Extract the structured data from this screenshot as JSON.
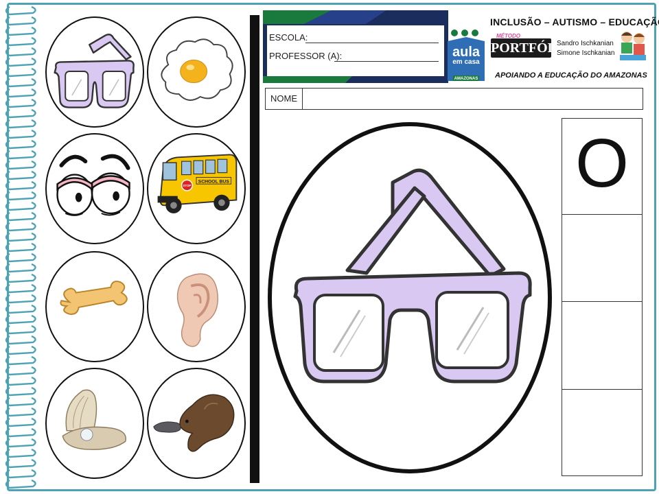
{
  "pictures": [
    {
      "name": "oculos"
    },
    {
      "name": "ovo"
    },
    {
      "name": "olhos"
    },
    {
      "name": "onibus",
      "bus_sign": "SCHOOL BUS",
      "stop_sign": "STOP"
    },
    {
      "name": "osso"
    },
    {
      "name": "orelha"
    },
    {
      "name": "ostra"
    },
    {
      "name": "ornitorrinco"
    }
  ],
  "form": {
    "escola_label": "ESCOLA: ",
    "professor_label": "PROFESSOR (A): "
  },
  "brand": {
    "title": "INCLUSÃO – AUTISMO – EDUCAÇÃO",
    "metodo": "MÉTODO",
    "portfolio": "PORTFÓLIO",
    "author1": "Sandro Ischkanian",
    "author2": "Simone Ischkanian",
    "aula_line1": "aula",
    "aula_line2": "em casa",
    "aula_badge": "AMAZONAS",
    "subtitle": "APOIANDO A EDUCAÇÃO DO AMAZONAS"
  },
  "nome_label": "NOME",
  "letter_grid": {
    "cells": [
      "O",
      "",
      "",
      ""
    ]
  },
  "colors": {
    "frame": "#4da3b3",
    "glasses": "#d9c9f2",
    "header_green": "#1a7a3e",
    "header_navy": "#1a2d5c",
    "aula_blue": "#2f6db5"
  }
}
